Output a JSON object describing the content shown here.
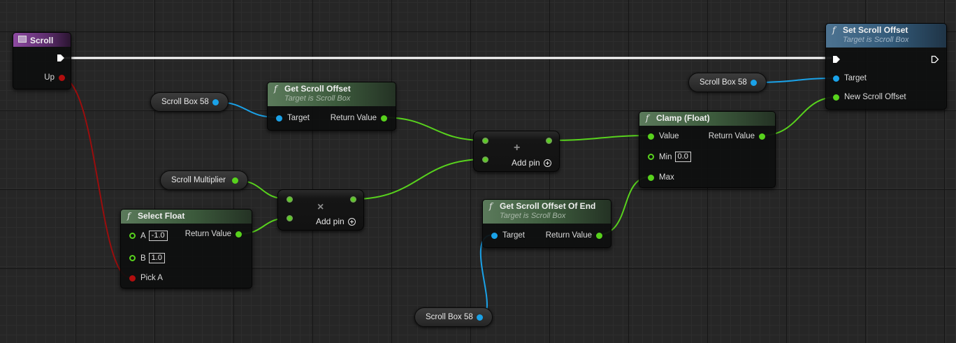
{
  "colors": {
    "exec": "#ffffff",
    "object_pin": "#1aa2e8",
    "float_pin": "#58d21d",
    "bool_pin": "#b10e0e",
    "pure_header": "#3c5a3c",
    "impure_header": "#335a79",
    "event_header": "#8e4aa2"
  },
  "event_scroll": {
    "title": "Scroll",
    "icon": "event-icon",
    "pin_up": "Up"
  },
  "set_scroll_offset": {
    "title": "Set Scroll Offset",
    "subtitle": "Target is Scroll Box",
    "pin_target": "Target",
    "pin_new_offset": "New Scroll Offset"
  },
  "get_scroll_offset": {
    "title": "Get Scroll Offset",
    "subtitle": "Target is Scroll Box",
    "pin_target": "Target",
    "pin_return": "Return Value"
  },
  "get_scroll_offset_end": {
    "title": "Get Scroll Offset Of End",
    "subtitle": "Target is Scroll Box",
    "pin_target": "Target",
    "pin_return": "Return Value"
  },
  "clamp": {
    "title": "Clamp (Float)",
    "pin_value": "Value",
    "pin_return": "Return Value",
    "pin_min": "Min",
    "min_value": "0.0",
    "pin_max": "Max"
  },
  "select_float": {
    "title": "Select Float",
    "pin_a": "A",
    "a_value": "-1.0",
    "pin_b": "B",
    "b_value": "1.0",
    "pin_pick_a": "Pick A",
    "pin_return": "Return Value"
  },
  "multiply": {
    "symbol": "×",
    "add_pin": "Add pin"
  },
  "add": {
    "symbol": "+",
    "add_pin": "Add pin"
  },
  "variables": {
    "scroll_box_1": "Scroll Box 58",
    "scroll_box_2": "Scroll Box 58",
    "scroll_box_3": "Scroll Box 58",
    "scroll_multiplier": "Scroll Multiplier"
  }
}
